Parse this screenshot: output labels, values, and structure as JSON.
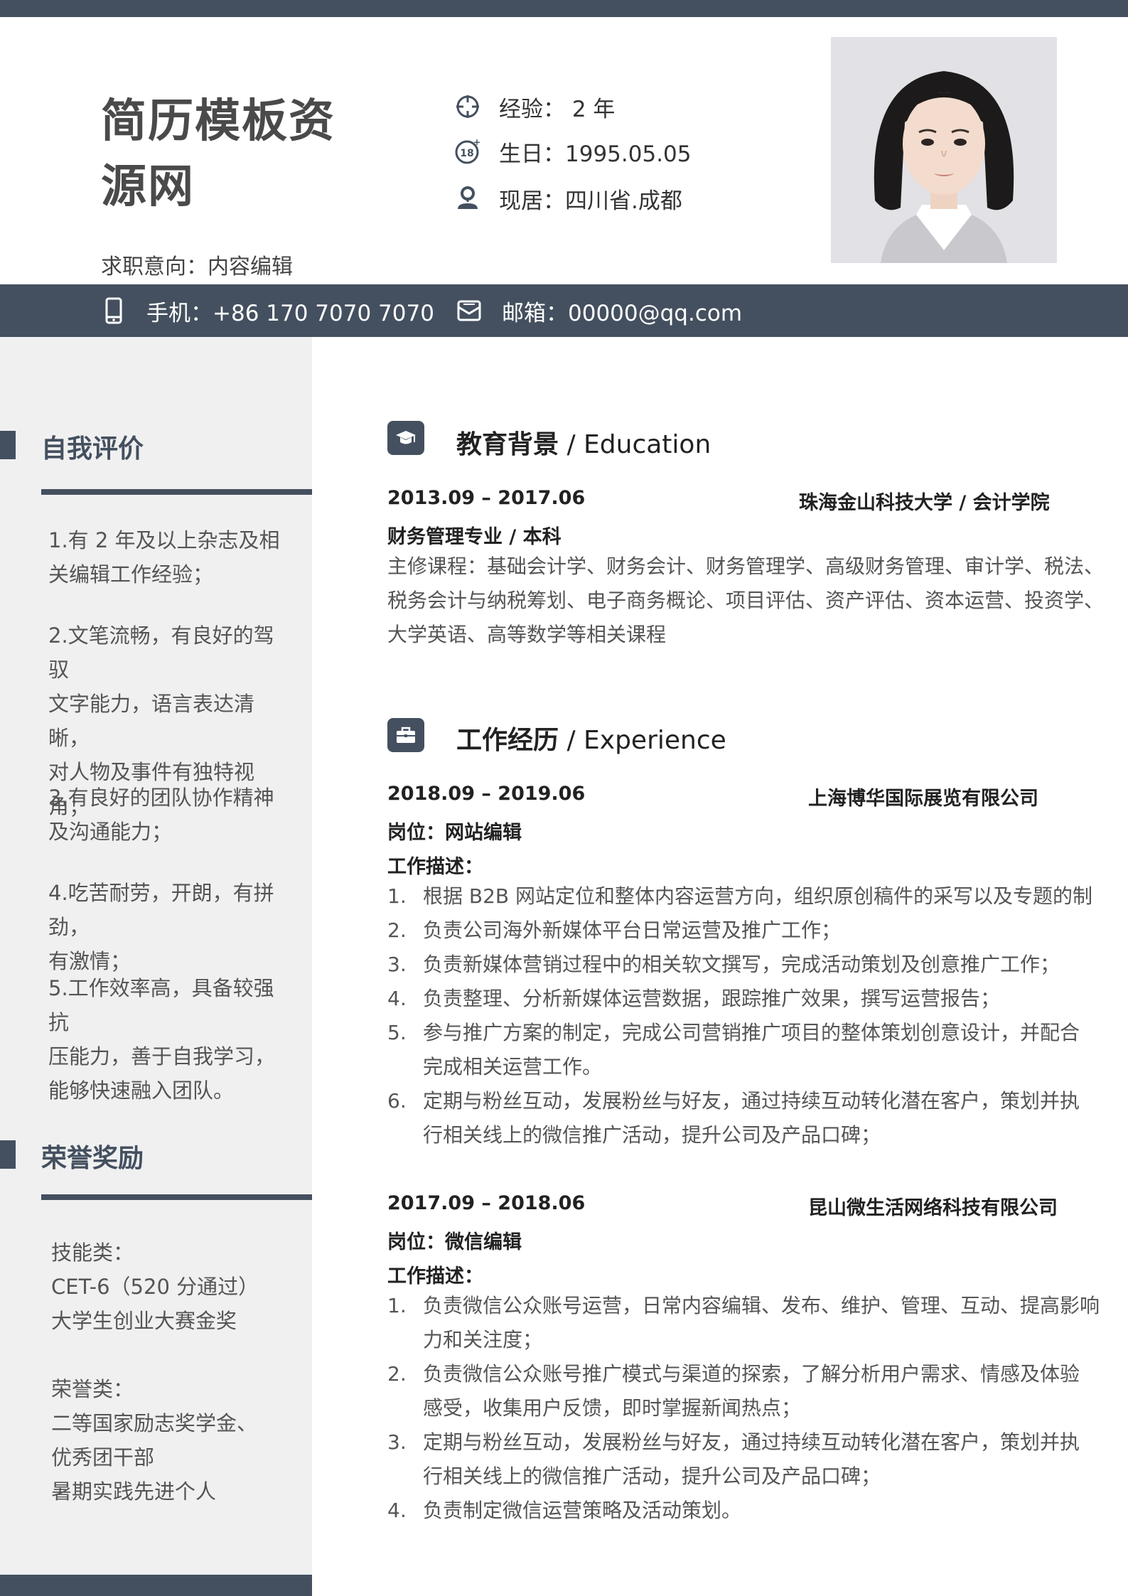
{
  "header": {
    "name": "简历模板资源网",
    "intent": "求职意向：内容编辑",
    "info": [
      {
        "icon": "crosshair-icon",
        "text": "经验：  2 年"
      },
      {
        "icon": "age-18-icon",
        "text": "生日：1995.05.05"
      },
      {
        "icon": "location-person-icon",
        "text": "现居：四川省.成都"
      }
    ]
  },
  "contact": {
    "phone": "手机：+86 170 7070 7070",
    "email": "邮箱：00000@qq.com"
  },
  "sidebar": {
    "self_eval": {
      "title": "自我评价",
      "items": [
        [
          "1.有 2 年及以上杂志及相",
          "关编辑工作经验；"
        ],
        [
          "2.文笔流畅，有良好的驾驭",
          "文字能力，语言表达清晰，",
          "对人物及事件有独特视",
          "角；"
        ],
        [
          "3.有良好的团队协作精神",
          "及沟通能力；"
        ],
        [
          "4.吃苦耐劳，开朗，有拼劲，",
          "有激情；"
        ],
        [
          "5.工作效率高，具备较强抗",
          "压能力，善于自我学习，",
          "能够快速融入团队。"
        ]
      ]
    },
    "honors": {
      "title": "荣誉奖励",
      "lines": [
        "技能类：",
        "CET-6（520 分通过）",
        "大学生创业大赛金奖",
        "",
        "荣誉类：",
        "二等国家励志奖学金、",
        "优秀团干部",
        "暑期实践先进个人"
      ]
    }
  },
  "education": {
    "title": "教育背景",
    "title_en": " / Education",
    "period": "2013.09 – 2017.06",
    "school": "珠海金山科技大学 / 会计学院",
    "major": "财务管理专业 / 本科",
    "courses": [
      "主修课程：基础会计学、财务会计、财务管理学、高级财务管理、审计学、税法、",
      "税务会计与纳税筹划、电子商务概论、项目评估、资产评估、资本运营、投资学、",
      "大学英语、高等数学等相关课程"
    ]
  },
  "experience": {
    "title": "工作经历",
    "title_en": " / Experience",
    "jobs": [
      {
        "period": "2018.09 – 2019.06",
        "company": "上海博华国际展览有限公司",
        "position": "岗位：网站编辑",
        "desc_label": "工作描述：",
        "items": [
          {
            "num": "1.",
            "lines": [
              "根据 B2B 网站定位和整体内容运营方向，组织原创稿件的采写以及专题的制"
            ]
          },
          {
            "num": "2.",
            "lines": [
              "负责公司海外新媒体平台日常运营及推广工作；"
            ]
          },
          {
            "num": "3.",
            "lines": [
              "负责新媒体营销过程中的相关软文撰写，完成活动策划及创意推广工作；"
            ]
          },
          {
            "num": "4.",
            "lines": [
              "负责整理、分析新媒体运营数据，跟踪推广效果，撰写运营报告；"
            ]
          },
          {
            "num": "5.",
            "lines": [
              "参与推广方案的制定，完成公司营销推广项目的整体策划创意设计，并配合",
              "完成相关运营工作。"
            ]
          },
          {
            "num": "6.",
            "lines": [
              "定期与粉丝互动，发展粉丝与好友，通过持续互动转化潜在客户，策划并执",
              "行相关线上的微信推广活动，提升公司及产品口碑；"
            ]
          }
        ]
      },
      {
        "period": "2017.09 – 2018.06",
        "company": "昆山微生活网络科技有限公司",
        "position": "岗位：微信编辑",
        "desc_label": "工作描述：",
        "items": [
          {
            "num": "1.",
            "lines": [
              "负责微信公众账号运营，日常内容编辑、发布、维护、管理、互动、提高影响",
              "力和关注度；"
            ]
          },
          {
            "num": "2.",
            "lines": [
              "负责微信公众账号推广模式与渠道的探索，了解分析用户需求、情感及体验",
              "感受，收集用户反馈，即时掌握新闻热点；"
            ]
          },
          {
            "num": "3.",
            "lines": [
              "定期与粉丝互动，发展粉丝与好友，通过持续互动转化潜在客户，策划并执",
              "行相关线上的微信推广活动，提升公司及产品口碑；"
            ]
          },
          {
            "num": "4.",
            "lines": [
              "负责制定微信运营策略及活动策划。"
            ]
          }
        ]
      }
    ]
  }
}
